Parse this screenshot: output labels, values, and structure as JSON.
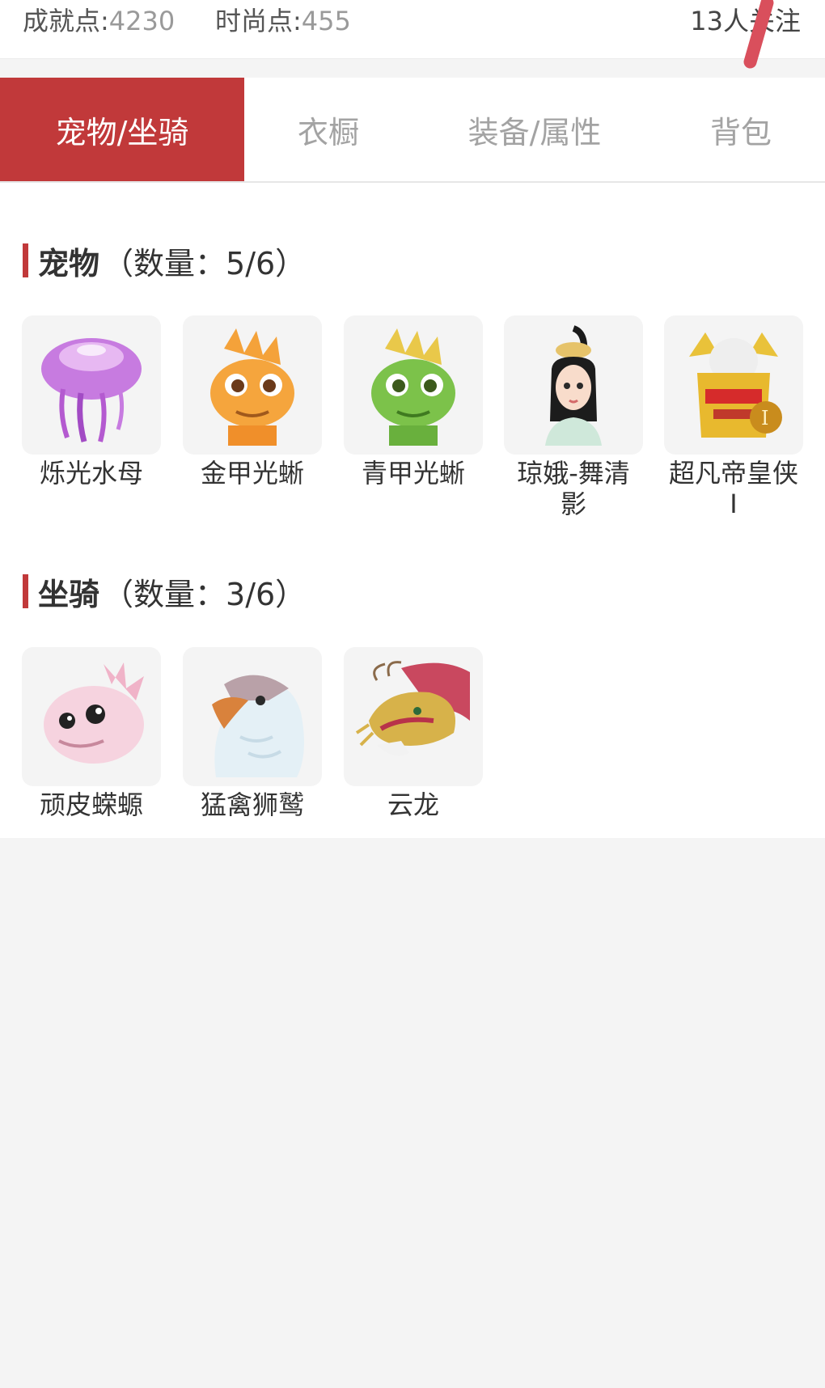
{
  "top": {
    "achievement_label": "成就点:",
    "achievement_value": "4230",
    "fashion_label": "时尚点:",
    "fashion_value": "455",
    "followers": "13人关注"
  },
  "tabs": [
    {
      "label": "宠物/坐骑",
      "active": true
    },
    {
      "label": "衣橱",
      "active": false
    },
    {
      "label": "装备/属性",
      "active": false
    },
    {
      "label": "背包",
      "active": false
    }
  ],
  "pets": {
    "title": "宠物",
    "count_text": "（数量：5/6）",
    "items": [
      {
        "name": "烁光水母",
        "icon": "jellyfish-icon"
      },
      {
        "name": "金甲光蜥",
        "icon": "gold-lizard-icon"
      },
      {
        "name": "青甲光蜥",
        "icon": "green-lizard-icon"
      },
      {
        "name": "琼娥-舞清影",
        "icon": "fairy-girl-icon"
      },
      {
        "name": "超凡帝皇侠Ⅰ",
        "icon": "armored-hero-icon"
      }
    ]
  },
  "mounts": {
    "title": "坐骑",
    "count_text": "（数量：3/6）",
    "items": [
      {
        "name": "顽皮蝾螈",
        "icon": "axolotl-icon"
      },
      {
        "name": "猛禽狮鹫",
        "icon": "griffin-icon"
      },
      {
        "name": "云龙",
        "icon": "cloud-dragon-icon"
      }
    ]
  },
  "colors": {
    "accent": "#c1393a",
    "page_bg": "#f4f4f4",
    "tab_inactive": "#a3a3a3"
  }
}
